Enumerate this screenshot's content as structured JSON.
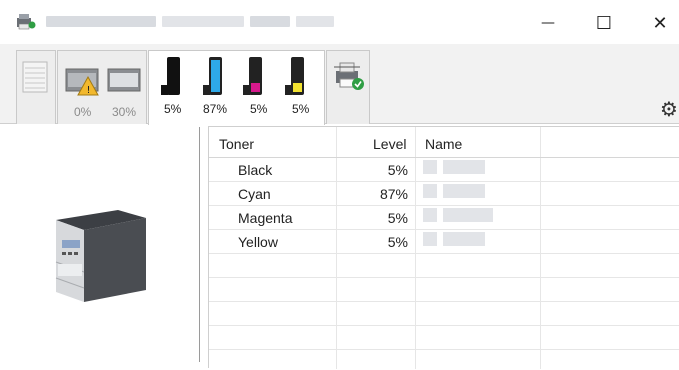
{
  "window": {
    "minimize_glyph": "—",
    "maximize_glyph": "☐",
    "close_glyph": "✕"
  },
  "tabs": [
    {
      "id": "paper",
      "icon": "paper-stack-icon",
      "label": ""
    },
    {
      "id": "waste",
      "icon": "waste-toner-warning-icon",
      "labels": [
        "0%",
        "30%"
      ]
    },
    {
      "id": "toner",
      "icon": "toner-cartridges-icon",
      "labels": [
        "5%",
        "87%",
        "5%",
        "5%"
      ],
      "colors": [
        "#111111",
        "#2ea9e8",
        "#d6198c",
        "#f2e230"
      ]
    },
    {
      "id": "device",
      "icon": "printer-status-ok-icon",
      "label": ""
    }
  ],
  "toolbar": {
    "collapse_glyph": "⌃",
    "settings_glyph": "⚙"
  },
  "table": {
    "headers": {
      "toner": "Toner",
      "level": "Level",
      "name": "Name"
    },
    "rows": [
      {
        "toner": "Black",
        "level": "5%"
      },
      {
        "toner": "Cyan",
        "level": "87%"
      },
      {
        "toner": "Magenta",
        "level": "5%"
      },
      {
        "toner": "Yellow",
        "level": "5%"
      }
    ]
  }
}
